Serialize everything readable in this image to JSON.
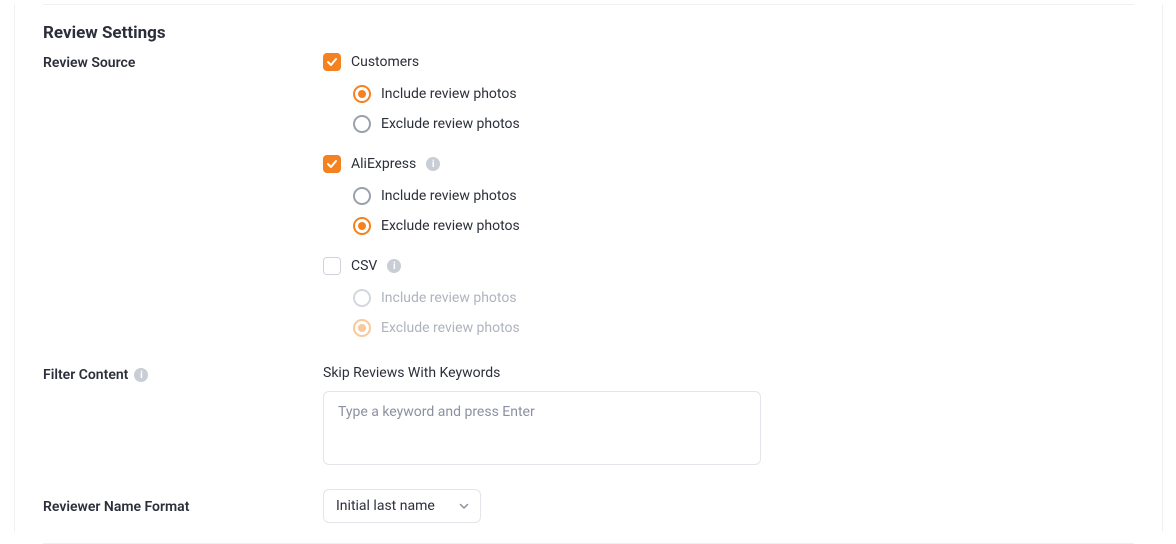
{
  "section_title": "Review Settings",
  "labels": {
    "review_source": "Review Source",
    "filter_content": "Filter Content",
    "reviewer_name_format": "Reviewer Name Format",
    "skip_keywords": "Skip Reviews With Keywords"
  },
  "sources": {
    "customers": {
      "label": "Customers",
      "checked": true,
      "options": {
        "include": "Include review photos",
        "exclude": "Exclude review photos",
        "selected": "include"
      }
    },
    "aliexpress": {
      "label": "AliExpress",
      "checked": true,
      "options": {
        "include": "Include review photos",
        "exclude": "Exclude review photos",
        "selected": "exclude"
      }
    },
    "csv": {
      "label": "CSV",
      "checked": false,
      "options": {
        "include": "Include review photos",
        "exclude": "Exclude review photos",
        "selected": "exclude"
      }
    }
  },
  "keyword_placeholder": "Type a keyword and press Enter",
  "name_format_selected": "Initial last name",
  "info_glyph": "i"
}
